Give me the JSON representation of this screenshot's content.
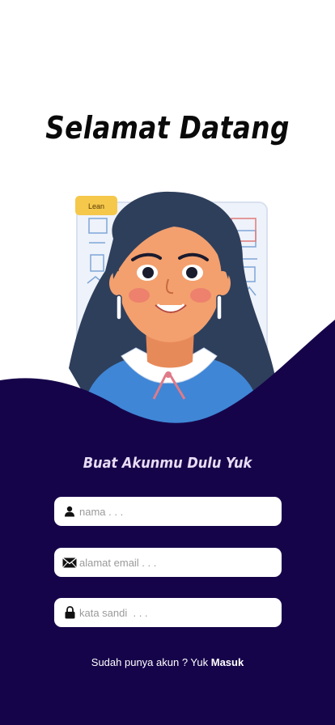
{
  "header": {
    "title": "Selamat Datang"
  },
  "illustration": {
    "badge_text": "Lean"
  },
  "form": {
    "subtitle": "Buat Akunmu Dulu Yuk",
    "name_placeholder": "nama . . .",
    "email_placeholder": "alamat email . . .",
    "password_placeholder": "kata sandi  . . ."
  },
  "footer": {
    "prompt": "Sudah punya akun ? Yuk ",
    "login_link": "Masuk"
  },
  "colors": {
    "background": "#ffffff",
    "panel": "#16044a",
    "subtitle": "#e8dcf5"
  },
  "icons": [
    "user-icon",
    "mail-icon",
    "lock-icon"
  ]
}
